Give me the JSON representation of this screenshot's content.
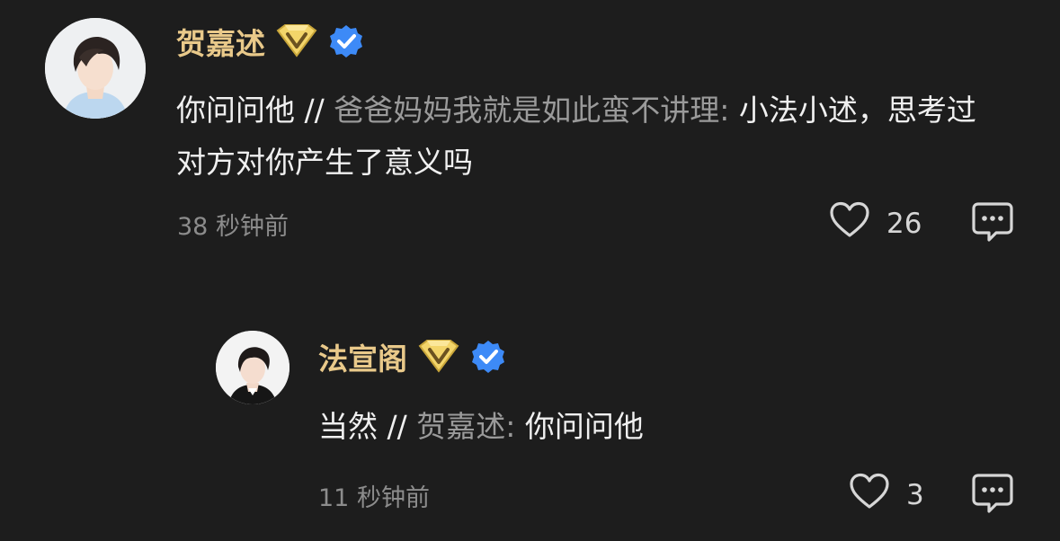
{
  "comments": [
    {
      "username": "贺嘉述",
      "badges": [
        "diamond-badge-icon",
        "verified-check-icon"
      ],
      "text_main": "你问问他",
      "separator": "//",
      "quoted_text": "爸爸妈妈我就是如此蛮不讲理:",
      "text_tail": "小法小述，思考过对方对你产生了意义吗",
      "time": "38 秒钟前",
      "likes": "26"
    },
    {
      "username": "法宣阁",
      "badges": [
        "diamond-badge-icon",
        "verified-check-icon"
      ],
      "text_main": "当然",
      "separator": "//",
      "quoted_text": "贺嘉述:",
      "text_tail": "你问问他",
      "time": "11 秒钟前",
      "likes": "3"
    }
  ],
  "colors": {
    "background": "#1d1d1d",
    "username": "#e9c98a",
    "text": "#f0f0f0",
    "quoted": "#9a9a9a",
    "meta": "#8c8c8c",
    "verified": "#3d8af7",
    "diamond": "#f3d56a"
  }
}
